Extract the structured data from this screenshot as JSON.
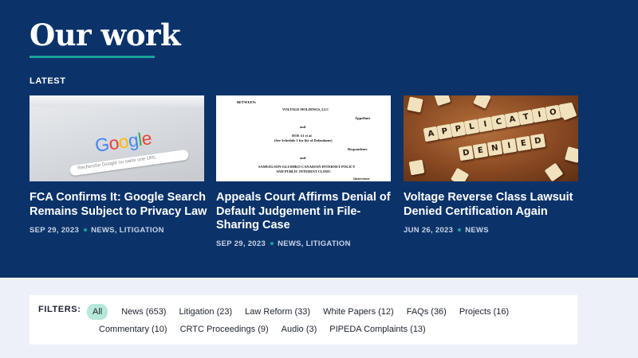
{
  "hero": {
    "title": "Our work",
    "section_label": "LATEST"
  },
  "cards": [
    {
      "title": "FCA Confirms It: Google Search Remains Subject to Privacy Law",
      "date": "SEP 29, 2023",
      "categories": "NEWS, LITIGATION",
      "thumb": {
        "logo_letters": [
          "G",
          "o",
          "o",
          "g",
          "l",
          "e"
        ],
        "logo_colors": [
          "#4285F4",
          "#EA4335",
          "#FBBC05",
          "#4285F4",
          "#34A853",
          "#EA4335"
        ],
        "search_placeholder": "Recherche Google ou saisir une URL"
      }
    },
    {
      "title": "Appeals Court Affirms Denial of Default Judgement in File-Sharing Case",
      "date": "SEP 29, 2023",
      "categories": "NEWS, LITIGATION",
      "thumb": {
        "doc_lines": [
          "BETWEEN:",
          "VOLTAGE HOLDINGS, LLC",
          "Appellant",
          "and",
          "DOE #1 et al",
          "(See Schedule 1 for list of Defendants)",
          "Respondents",
          "and",
          "SAMUELSON-GLUSHKO CANADIAN INTERNET POLICY",
          "AND PUBLIC INTEREST CLINIC",
          "Intervener"
        ]
      }
    },
    {
      "title": "Voltage Reverse Class Lawsuit Denied Certification Again",
      "date": "JUN 26, 2023",
      "categories": "NEWS",
      "thumb": {
        "word_1": "APPLICATION",
        "word_2": "DENIED"
      }
    }
  ],
  "filters": {
    "label": "FILTERS:",
    "row_1": [
      "All",
      "News (653)",
      "Litigation (23)",
      "Law Reform (33)",
      "White Papers (12)",
      "FAQs (36)",
      "Projects (16)"
    ],
    "row_2": [
      "Commentary (10)",
      "CRTC Proceedings (9)",
      "Audio (3)",
      "PIPEDA Complaints (13)"
    ],
    "active": "All"
  },
  "colors": {
    "hero_bg": "#0b336a",
    "accent": "#19a39a",
    "active_chip": "#b6e8d9",
    "page_bg": "#eef0f9"
  }
}
